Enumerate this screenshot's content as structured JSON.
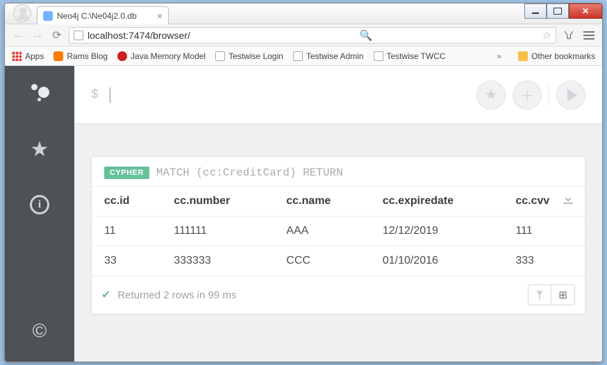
{
  "window": {
    "tab_title": "Neo4j C:\\Ne04j2.0.db"
  },
  "urlbar": {
    "url_display": "localhost:7474/browser/",
    "host": "localhost"
  },
  "bookmarks": {
    "apps": "Apps",
    "items": [
      {
        "label": "Rams Blog",
        "icon": "blog"
      },
      {
        "label": "Java Memory Model",
        "icon": "java"
      },
      {
        "label": "Testwise Login",
        "icon": "doc"
      },
      {
        "label": "Testwise Admin",
        "icon": "doc"
      },
      {
        "label": "Testwise TWCC",
        "icon": "doc"
      }
    ],
    "more": "»",
    "other": "Other bookmarks"
  },
  "editor": {
    "prompt": "$"
  },
  "query": {
    "badge": "CYPHER",
    "text": "MATCH (cc:CreditCard) RETURN"
  },
  "table": {
    "columns": [
      "cc.id",
      "cc.number",
      "cc.name",
      "cc.expiredate",
      "cc.cvv"
    ],
    "rows": [
      [
        "11",
        "111111",
        "AAA",
        "12/12/2019",
        "111"
      ],
      [
        "33",
        "333333",
        "CCC",
        "01/10/2016",
        "333"
      ]
    ]
  },
  "status": "Returned 2 rows in 99 ms"
}
